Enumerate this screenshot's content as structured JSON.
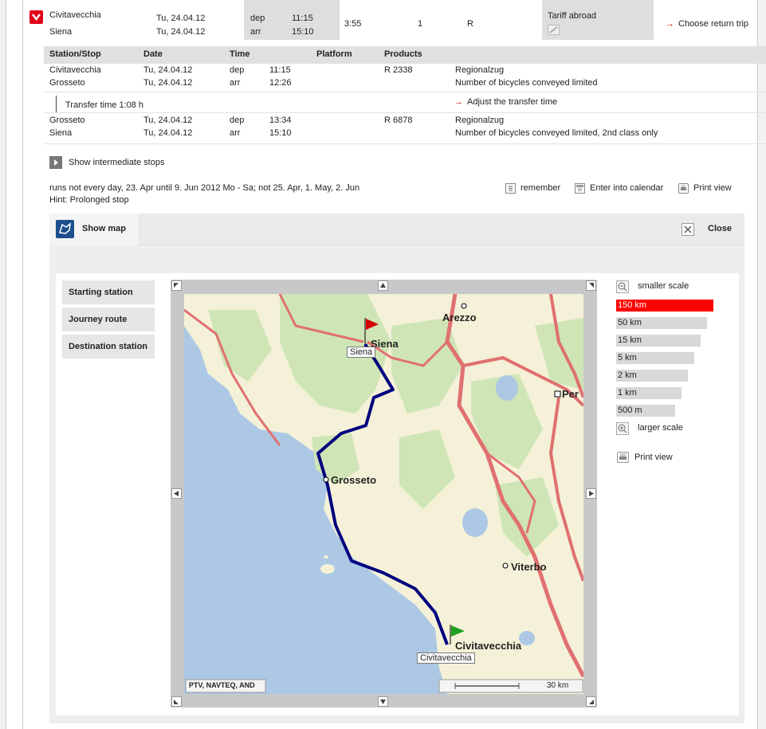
{
  "summary": {
    "from_station": "Civitavecchia",
    "to_station": "Siena",
    "dep_date": "Tu, 24.04.12",
    "arr_date": "Tu, 24.04.12",
    "dep_label": "dep",
    "arr_label": "arr",
    "dep_time": "11:15",
    "arr_time": "15:10",
    "duration": "3:55",
    "changes": "1",
    "products": "R",
    "tariff_label": "Tariff abroad",
    "return_trip_label": "Choose return trip"
  },
  "detail": {
    "headers": {
      "station": "Station/Stop",
      "date": "Date",
      "time": "Time",
      "platform": "Platform",
      "products": "Products"
    },
    "legs": [
      {
        "dep_station": "Civitavecchia",
        "dep_date": "Tu, 24.04.12",
        "dep_label": "dep",
        "dep_time": "11:15",
        "arr_station": "Grosseto",
        "arr_date": "Tu, 24.04.12",
        "arr_label": "arr",
        "arr_time": "12:26",
        "train": "R 2338",
        "train_type": "Regionalzug",
        "note": "Number of bicycles conveyed limited"
      },
      {
        "dep_station": "Grosseto",
        "dep_date": "Tu, 24.04.12",
        "dep_label": "dep",
        "dep_time": "13:34",
        "arr_station": "Siena",
        "arr_date": "Tu, 24.04.12",
        "arr_label": "arr",
        "arr_time": "15:10",
        "train": "R 6878",
        "train_type": "Regionalzug",
        "note": "Number of bicycles conveyed limited, 2nd class only"
      }
    ],
    "transfer_time": "Transfer time 1:08 h",
    "adjust_transfer": "Adjust the transfer time",
    "intermediate_stops": "Show intermediate stops",
    "runs_note": "runs not every day, 23. Apr until 9. Jun 2012 Mo - Sa; not 25. Apr, 1. May, 2. Jun",
    "hint": "Hint: Prolonged stop",
    "remember": "remember",
    "calendar": "Enter into calendar",
    "print": "Print view"
  },
  "map": {
    "tab_label": "Show map",
    "close_label": "Close",
    "left_buttons": [
      "Starting station",
      "Journey route",
      "Destination station"
    ],
    "smaller_scale": "smaller scale",
    "larger_scale": "larger scale",
    "scales": [
      "150 km",
      "50 km",
      "15 km",
      "5 km",
      "2 km",
      "1 km",
      "500 m"
    ],
    "selected_scale": "150 km",
    "print_view": "Print view",
    "copyright": "PTV, NAVTEQ, AND",
    "scale_label": "30 km",
    "places": {
      "siena": "Siena",
      "siena_box": "Siena",
      "arezzo": "Arezzo",
      "perugia": "Per",
      "grosseto": "Grosseto",
      "viterbo": "Viterbo",
      "civitavecchia": "Civitavecchia",
      "civitavecchia_box": "Civitavecchia"
    },
    "colors": {
      "route": "#00007f",
      "selected_scale": "#ff0000",
      "sea": "#acc8e4",
      "land": "#f4f1d8",
      "forest": "#cfe5b6",
      "road": "#e07070"
    }
  }
}
